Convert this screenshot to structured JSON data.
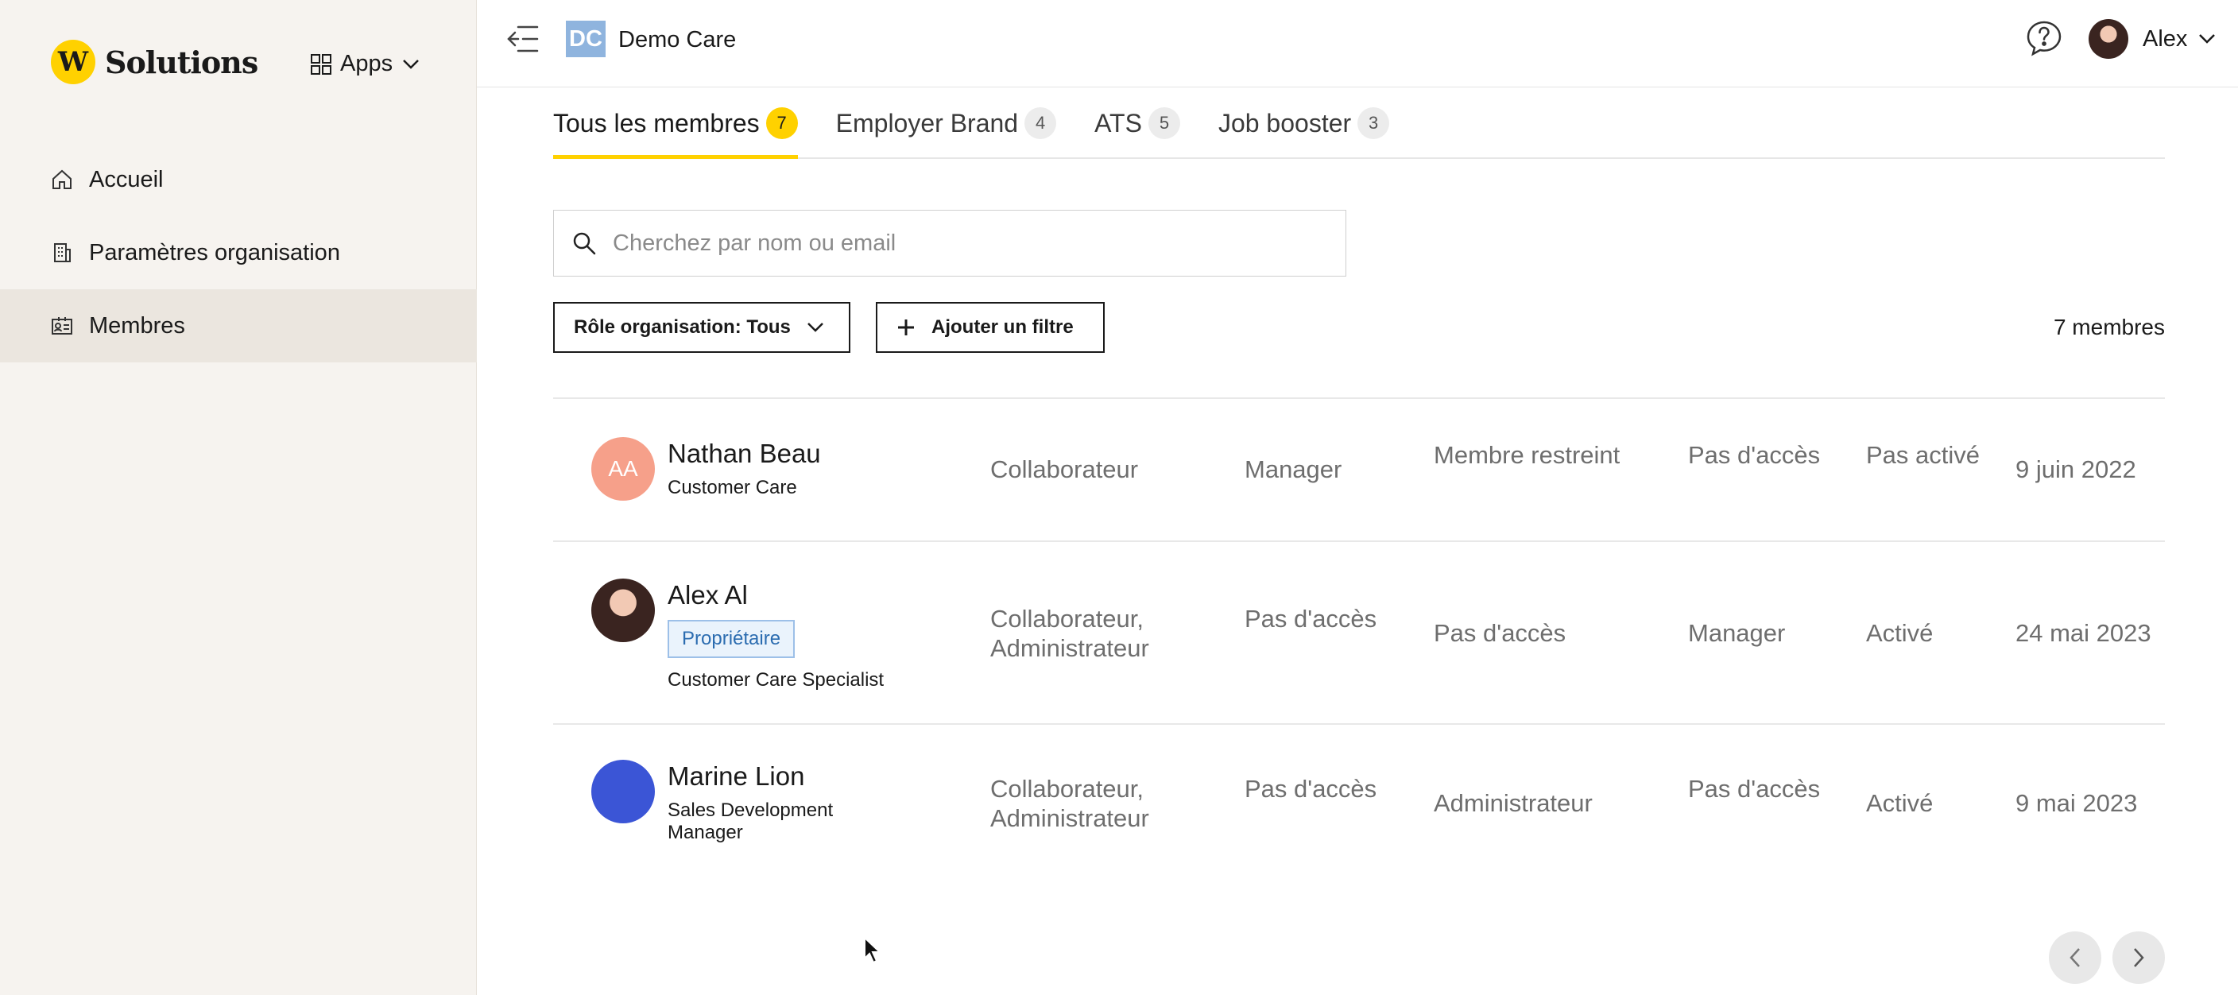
{
  "brand": {
    "logo_letter": "W",
    "name": "Solutions"
  },
  "apps": {
    "label": "Apps"
  },
  "sidebar": {
    "items": [
      {
        "label": "Accueil",
        "icon": "home-icon"
      },
      {
        "label": "Paramètres organisation",
        "icon": "building-icon"
      },
      {
        "label": "Membres",
        "icon": "id-card-icon",
        "active": true
      }
    ]
  },
  "topbar": {
    "org_initials": "DC",
    "org_name": "Demo Care",
    "user_name": "Alex"
  },
  "tabs": [
    {
      "label": "Tous les membres",
      "count": "7",
      "active": true
    },
    {
      "label": "Employer Brand",
      "count": "4"
    },
    {
      "label": "ATS",
      "count": "5"
    },
    {
      "label": "Job booster",
      "count": "3"
    }
  ],
  "search": {
    "placeholder": "Cherchez par nom ou email",
    "value": ""
  },
  "filters": {
    "role_label": "Rôle organisation: Tous",
    "add_label": "Ajouter un filtre"
  },
  "members_count": "7 membres",
  "members": [
    {
      "initials": "AA",
      "name": "Nathan Beau",
      "title": "Customer Care",
      "col1": "Collaborateur",
      "col2": "Manager",
      "col3": "Membre restreint",
      "col4": "Pas d'accès",
      "col5": "Pas activé",
      "date": "9 juin 2022"
    },
    {
      "name": "Alex Al",
      "badge": "Propriétaire",
      "title": "Customer Care Specialist",
      "col1": "Collaborateur, Administrateur",
      "col2": "Pas d'accès",
      "col3": "Pas d'accès",
      "col4": "Manager",
      "col5": "Activé",
      "date": "24 mai 2023"
    },
    {
      "name": "Marine Lion",
      "title": "Sales Development Manager",
      "col1": "Collaborateur, Administrateur",
      "col2": "Pas d'accès",
      "col3": "Administrateur",
      "col4": "Pas d'accès",
      "col5": "Activé",
      "date": "9 mai 2023"
    }
  ],
  "colors": {
    "accent": "#ffd100",
    "sidebar_bg": "#f6f3ef",
    "org_badge": "#8fb4de",
    "avatar_initials": "#f6a08a",
    "avatar_blue": "#3b55d6"
  }
}
